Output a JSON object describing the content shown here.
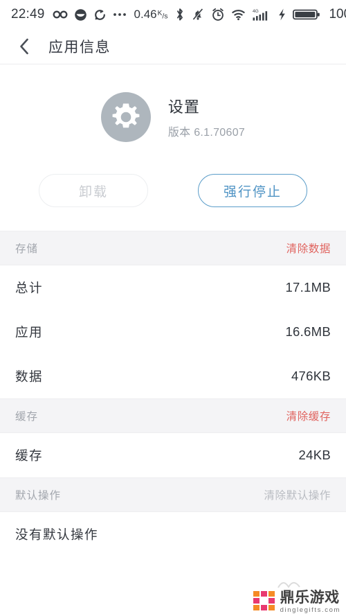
{
  "statusbar": {
    "clock": "22:49",
    "icons_left": [
      "infinity-icon",
      "moon-face-icon",
      "sync-icon",
      "more-dots-icon"
    ],
    "network_speed": "0.46",
    "network_speed_unit_top": "K",
    "network_speed_unit_bottom": "s",
    "icons_right": [
      "bluetooth-icon",
      "mute-bell-icon",
      "alarm-clock-icon",
      "wifi-icon",
      "signal-4g-icon",
      "charging-bolt-icon",
      "battery-icon"
    ],
    "signal_label": "4G",
    "battery_percent": "100"
  },
  "appbar": {
    "back_icon": "back-chevron-icon",
    "title": "应用信息"
  },
  "app": {
    "icon": "settings-gear-icon",
    "name": "设置",
    "version": "版本 6.1.70607"
  },
  "actions": {
    "uninstall_label": "卸载",
    "force_stop_label": "强行停止"
  },
  "sections": [
    {
      "title": "存储",
      "action_label": "清除数据",
      "action_style": "red",
      "rows": [
        {
          "label": "总计",
          "value": "17.1MB"
        },
        {
          "label": "应用",
          "value": "16.6MB"
        },
        {
          "label": "数据",
          "value": "476KB"
        }
      ]
    },
    {
      "title": "缓存",
      "action_label": "清除缓存",
      "action_style": "red",
      "rows": [
        {
          "label": "缓存",
          "value": "24KB"
        }
      ]
    },
    {
      "title": "默认操作",
      "action_label": "清除默认操作",
      "action_style": "gray",
      "rows": [
        {
          "label": "没有默认操作",
          "value": ""
        }
      ]
    }
  ],
  "watermark": {
    "brand_cn": "鼎乐游戏",
    "brand_en": "dinglegifts.com",
    "color_pink": "#e8336c",
    "color_orange": "#f5881f"
  },
  "colors": {
    "accent_blue": "#4e93c4",
    "accent_red": "#e0645f",
    "section_bg": "#f4f4f6",
    "text_primary": "#33373e",
    "text_muted": "#a2a6ad"
  }
}
